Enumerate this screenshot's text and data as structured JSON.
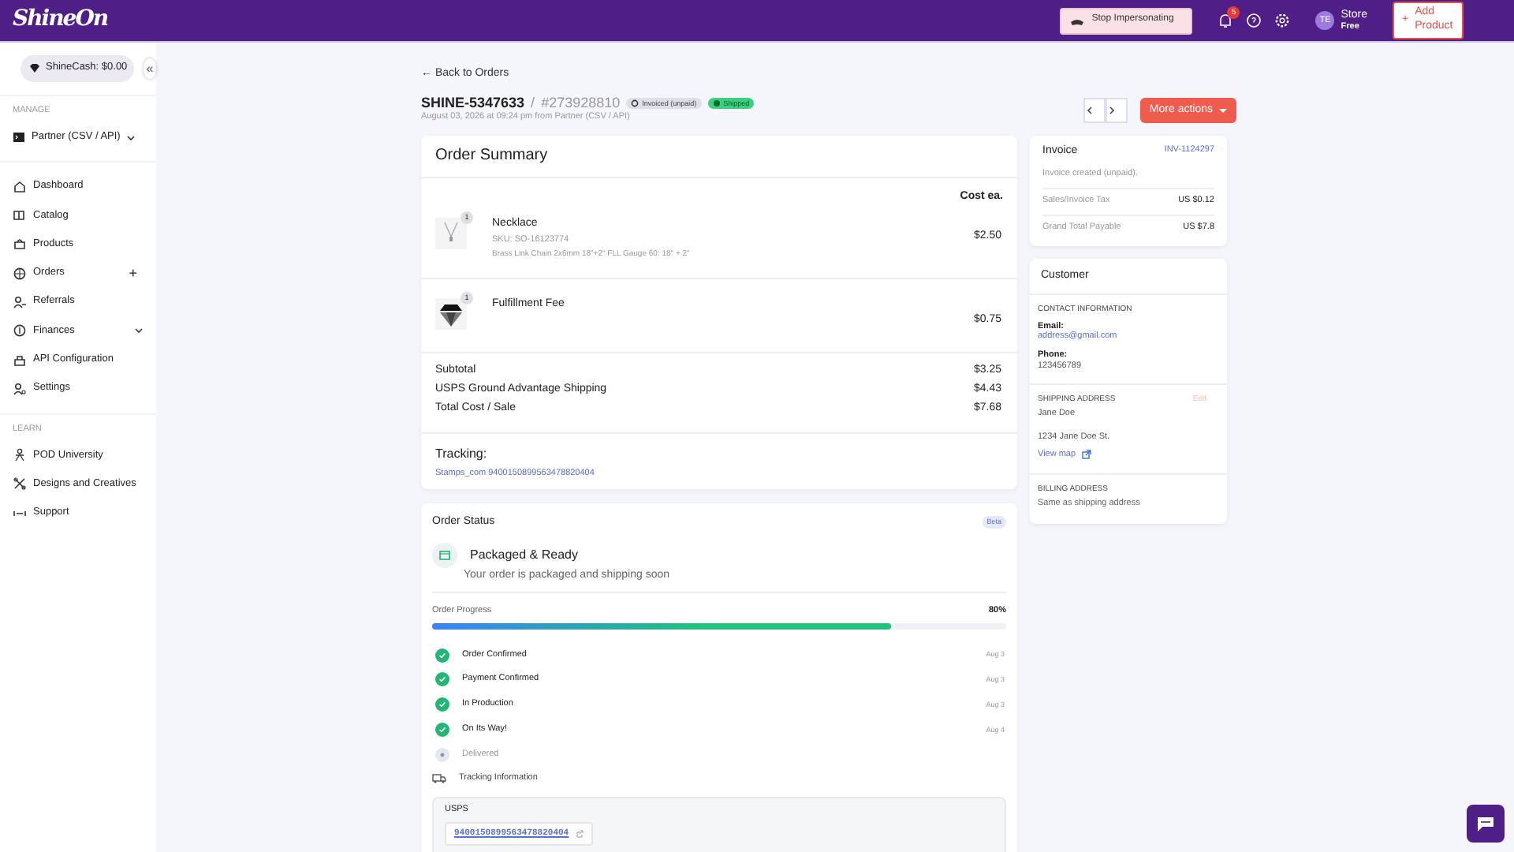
{
  "header": {
    "logo": "ShineOn",
    "impersonate": "Stop Impersonating",
    "notifications": "5",
    "avatar": "TE",
    "user": "Store",
    "plan": "Free",
    "add_product": {
      "icon": "+",
      "label": "Add Product"
    }
  },
  "sidebar": {
    "cash": "ShineCash: $0.00",
    "collapse": "«",
    "sections": [
      {
        "label": "MANAGE",
        "account": "Partner (CSV / API)",
        "items": [
          {
            "label": "Dashboard"
          },
          {
            "label": "Catalog"
          },
          {
            "label": "Products"
          },
          {
            "label": "Orders",
            "trail": "+"
          },
          {
            "label": "Referrals"
          },
          {
            "label": "Finances",
            "expandable": true
          },
          {
            "label": "API Configuration"
          },
          {
            "label": "Settings"
          }
        ]
      },
      {
        "label": "LEARN",
        "items": [
          {
            "label": "POD University"
          },
          {
            "label": "Designs and Creatives"
          },
          {
            "label": "Support"
          }
        ]
      }
    ]
  },
  "order": {
    "back": "← Back to Orders",
    "id": "SHINE-5347633",
    "sep": "/",
    "number": "#273928810",
    "badges": [
      {
        "label": "Invoiced (unpaid)",
        "kind": "invoiced"
      },
      {
        "label": "Shipped",
        "kind": "shipped"
      }
    ],
    "date": "August 03, 2026 at 09:24 pm from Partner (CSV / API)",
    "more_actions": "More actions"
  },
  "summary": {
    "title": "Order Summary",
    "cost_header": "Cost ea.",
    "items": [
      {
        "qty": "1",
        "name": "Necklace",
        "sku": "SKU: SO-16123774",
        "variant": "Brass Link Chain 2x6mm 18\"+2\" FLL Gauge 60: 18\" + 2\"",
        "price": "$2.50"
      },
      {
        "qty": "1",
        "name": "Fulfillment Fee",
        "price": "$0.75"
      }
    ],
    "totals": [
      {
        "label": "Subtotal",
        "value": "$3.25"
      },
      {
        "label": "USPS Ground Advantage Shipping",
        "value": "$4.43"
      },
      {
        "label": "Total Cost / Sale",
        "value": "$7.68"
      }
    ],
    "tracking_label": "Tracking:",
    "tracking_link": "Stamps_com 9400150899563478820404"
  },
  "status": {
    "title": "Order Status",
    "badge": "Beta",
    "headline": "Packaged & Ready",
    "message": "Your order is packaged and shipping soon",
    "progress_label": "Order Progress",
    "percent": "80%",
    "level": 0.8,
    "steps": [
      {
        "label": "Order Confirmed",
        "date": "Aug 3",
        "done": true
      },
      {
        "label": "Payment Confirmed",
        "date": "Aug 3",
        "done": true
      },
      {
        "label": "In Production",
        "date": "Aug 3",
        "done": true
      },
      {
        "label": "On Its Way!",
        "date": "Aug 4",
        "done": true
      },
      {
        "label": "Delivered",
        "done": false
      }
    ],
    "tracking_info": "Tracking Information",
    "carrier": "USPS",
    "tracking_number": "9400150899563478820404"
  },
  "invoice": {
    "title": "Invoice",
    "number": "INV-1124297",
    "note": "Invoice created (unpaid).",
    "rows": [
      {
        "label": "Sales/Invoice Tax",
        "value": "US $0.12"
      },
      {
        "label": "Grand Total Payable",
        "value": "US $7.8"
      }
    ]
  },
  "customer": {
    "title": "Customer",
    "contact_heading": "CONTACT INFORMATION",
    "email_label": "Email:",
    "email": "address@gmail.com",
    "phone_label": "Phone:",
    "phone": "123456789",
    "shipping_heading": "SHIPPING ADDRESS",
    "edit": "Edit",
    "ship_name": "Jane Doe",
    "ship_street": "1234 Jane Doe St.",
    "view_map": "View map",
    "billing_heading": "BILLING ADDRESS",
    "billing": "Same as shipping address"
  }
}
